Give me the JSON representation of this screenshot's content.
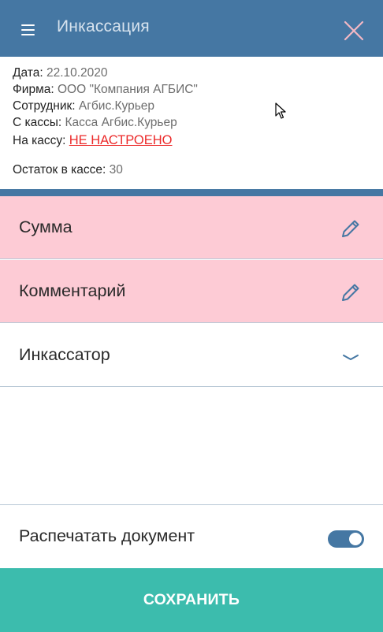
{
  "appbar": {
    "title": "Инкассация",
    "menu_icon": "hamburger-menu-icon",
    "close_icon": "close-x-icon",
    "color": "#4577a3"
  },
  "info": {
    "date_label": "Дата:",
    "date_value": "22.10.2020",
    "firm_label": "Фирма:",
    "firm_value": "ООО \"Компания АГБИС\"",
    "employee_label": "Сотрудник:",
    "employee_value": "Агбис.Курьер",
    "from_cash_label": "С кассы:",
    "from_cash_value": "Касса Агбис.Курьер",
    "to_cash_label": "На кассу:",
    "to_cash_value": "НЕ НАСТРОЕНО",
    "balance_label": "Остаток в кассе:",
    "balance_value": "30"
  },
  "fields": {
    "sum_label": "Сумма",
    "comment_label": "Комментарий",
    "collector_label": "Инкассатор",
    "edit_icon": "pencil-icon",
    "dropdown_icon": "chevron-down-icon",
    "required_color": "#fdcbd5"
  },
  "print": {
    "label": "Распечатать документ",
    "enabled": true
  },
  "save_button": {
    "label": "СОХРАНИТЬ",
    "color": "#3cbcad"
  }
}
